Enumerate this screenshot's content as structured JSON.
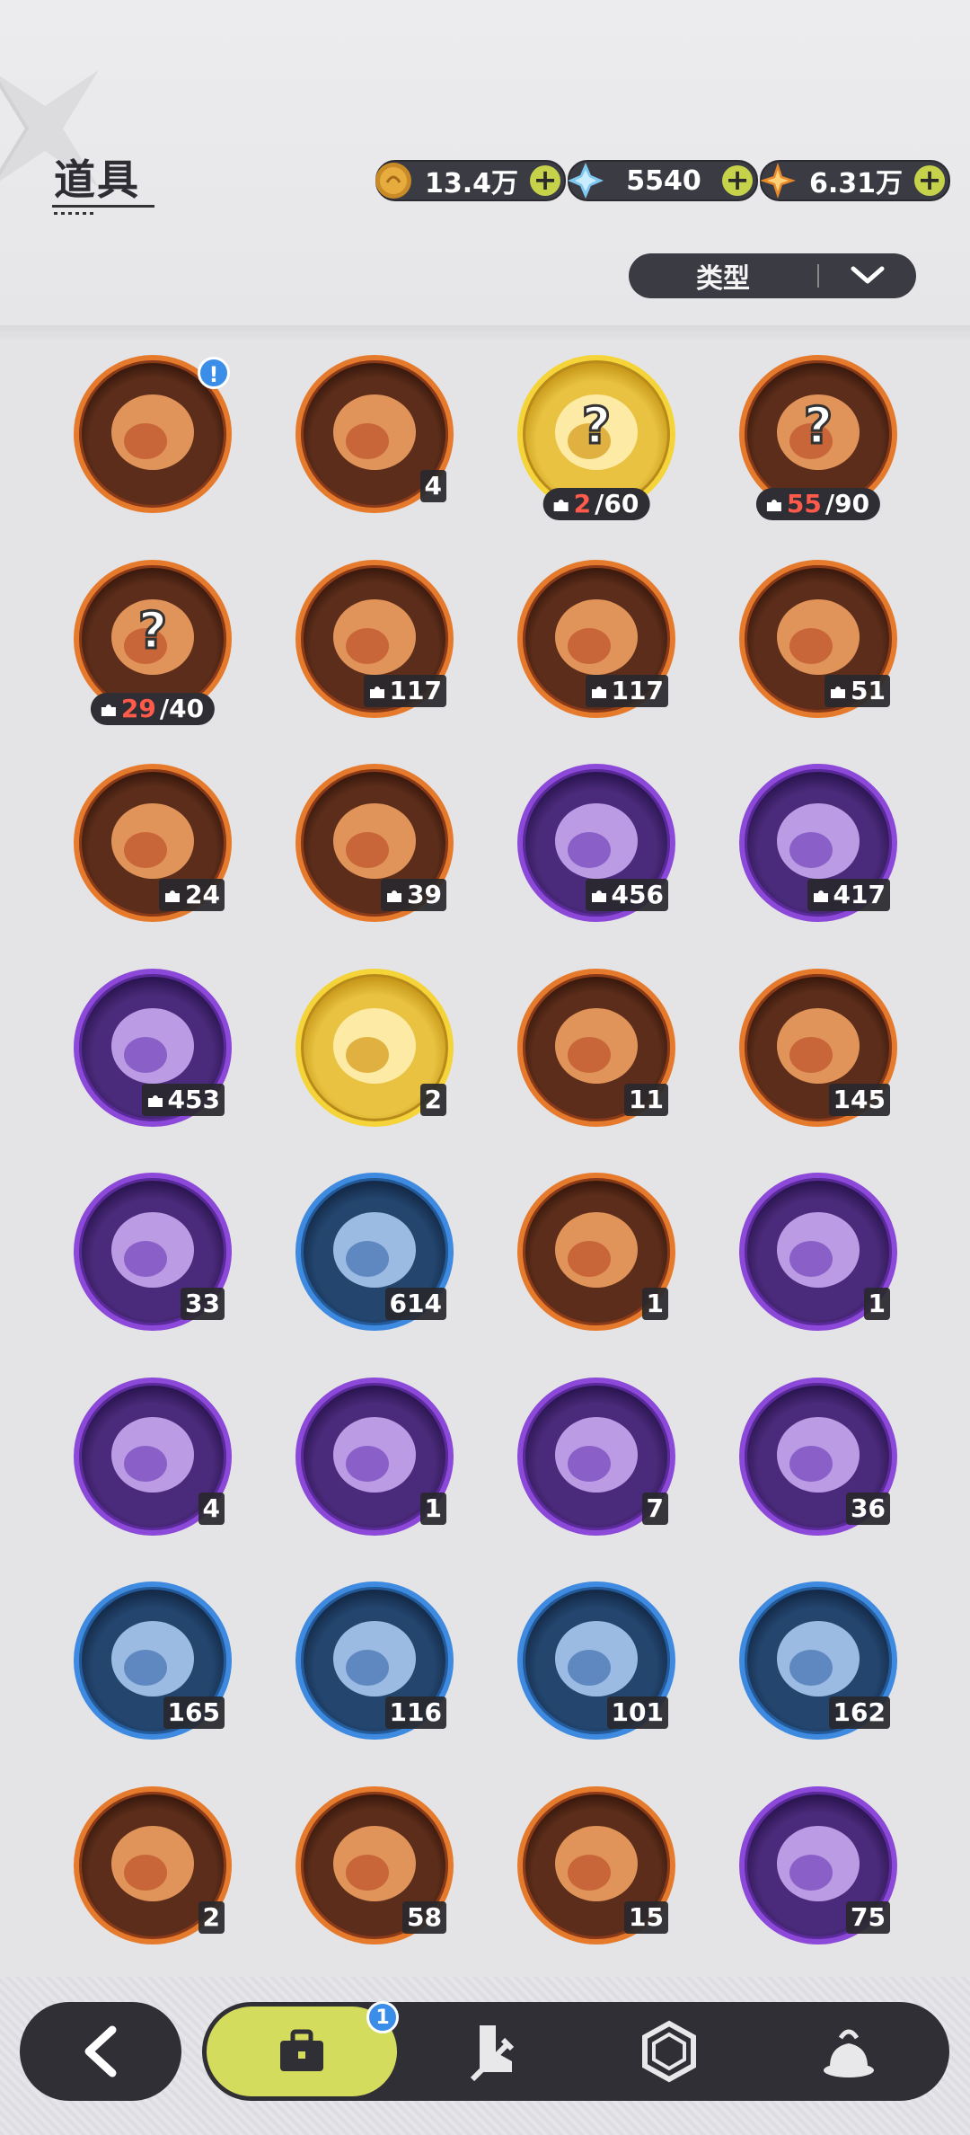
{
  "header": {
    "title": "道具",
    "currencies": [
      {
        "icon": "gold-coin-icon",
        "value": "13.4万",
        "plus": "+"
      },
      {
        "icon": "crystal-icon",
        "value": "5540",
        "plus": "+"
      },
      {
        "icon": "star-shard-icon",
        "value": "6.31万",
        "plus": "+"
      }
    ],
    "filter": {
      "label": "类型",
      "icon": "chevron-down-icon"
    }
  },
  "items": [
    {
      "name": "treasure-chest",
      "rarity": "orange",
      "alert": "!"
    },
    {
      "name": "purple-crystal",
      "rarity": "orange",
      "count": "4"
    },
    {
      "name": "mystery-pet-fragment-gold",
      "rarity": "gold",
      "fragments": {
        "have": "2",
        "need": "/60"
      }
    },
    {
      "name": "mystery-pet-fragment-orange",
      "rarity": "orange",
      "fragments": {
        "have": "55",
        "need": "/90"
      }
    },
    {
      "name": "mystery-pet-fragment-white",
      "rarity": "orange",
      "fragments": {
        "have": "29",
        "need": "/40"
      }
    },
    {
      "name": "brown-bear-pet-fragment",
      "rarity": "orange",
      "count": "117",
      "fragment": true
    },
    {
      "name": "knight-pet-fragment",
      "rarity": "orange",
      "count": "117",
      "fragment": true
    },
    {
      "name": "white-bunny-pet-fragment",
      "rarity": "orange",
      "count": "51",
      "fragment": true
    },
    {
      "name": "dark-bear-pet-fragment",
      "rarity": "orange",
      "count": "24",
      "fragment": true
    },
    {
      "name": "purple-cat-pet-fragment",
      "rarity": "orange",
      "count": "39",
      "fragment": true
    },
    {
      "name": "green-eye-pet-fragment",
      "rarity": "purple",
      "count": "456",
      "fragment": true
    },
    {
      "name": "red-eye-bear-pet-fragment",
      "rarity": "purple",
      "count": "417",
      "fragment": true
    },
    {
      "name": "yellow-blob-pet-fragment",
      "rarity": "purple",
      "count": "453",
      "fragment": true
    },
    {
      "name": "gold-character-card",
      "rarity": "gold",
      "count": "2"
    },
    {
      "name": "rainbow-character-card",
      "rarity": "orange",
      "count": "11"
    },
    {
      "name": "orange-character-card",
      "rarity": "orange",
      "count": "145"
    },
    {
      "name": "purple-character-card",
      "rarity": "purple",
      "count": "33"
    },
    {
      "name": "blue-character-card",
      "rarity": "blue",
      "count": "614"
    },
    {
      "name": "refresh-card",
      "rarity": "orange",
      "count": "1"
    },
    {
      "name": "gift-box",
      "rarity": "purple",
      "count": "1"
    },
    {
      "name": "golden-crown-orb",
      "rarity": "purple",
      "count": "4"
    },
    {
      "name": "magic-mirror",
      "rarity": "purple",
      "count": "1"
    },
    {
      "name": "scroll",
      "rarity": "purple",
      "count": "7"
    },
    {
      "name": "pink-apple",
      "rarity": "purple",
      "count": "36"
    },
    {
      "name": "shovel",
      "rarity": "blue",
      "count": "165"
    },
    {
      "name": "boxing-glove",
      "rarity": "blue",
      "count": "116"
    },
    {
      "name": "pickaxe",
      "rarity": "blue",
      "count": "101"
    },
    {
      "name": "hammer",
      "rarity": "blue",
      "count": "162"
    },
    {
      "name": "golden-key",
      "rarity": "orange",
      "count": "2"
    },
    {
      "name": "ruby-gem",
      "rarity": "orange",
      "count": "58"
    },
    {
      "name": "rainbow-ticket",
      "rarity": "orange",
      "count": "15"
    },
    {
      "name": "fist-coin",
      "rarity": "purple",
      "count": "75"
    }
  ],
  "nav": {
    "back_icon": "back-arrow-icon",
    "tabs": [
      {
        "icon": "briefcase-icon",
        "active": true,
        "badge": "1"
      },
      {
        "icon": "boot-sword-icon"
      },
      {
        "icon": "hexagon-gem-icon"
      },
      {
        "icon": "pudding-icon"
      }
    ]
  }
}
